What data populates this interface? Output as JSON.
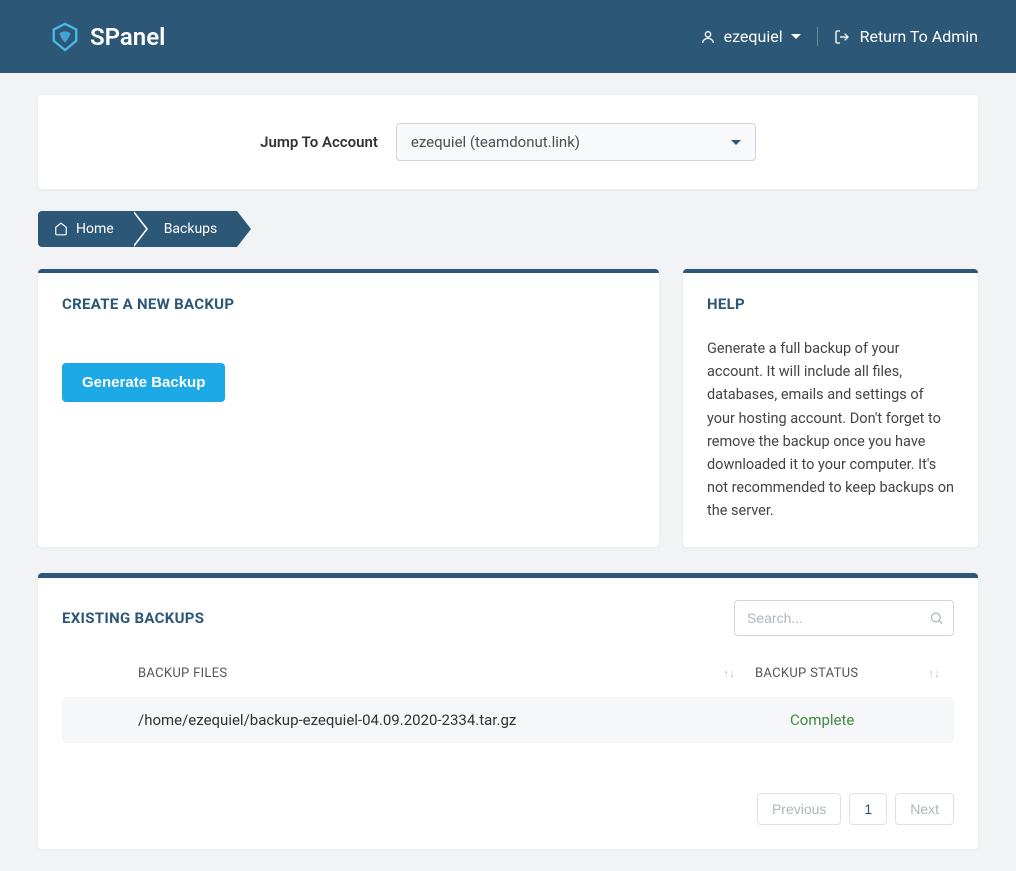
{
  "header": {
    "brand": "SPanel",
    "username": "ezequiel",
    "return_link": "Return To Admin"
  },
  "jump": {
    "label": "Jump To Account",
    "selected": "ezequiel (teamdonut.link)"
  },
  "breadcrumb": {
    "home": "Home",
    "current": "Backups"
  },
  "create_card": {
    "title": "CREATE A NEW BACKUP",
    "button": "Generate Backup"
  },
  "help_card": {
    "title": "HELP",
    "text": "Generate a full backup of your account. It will include all files, databases, emails and settings of your hosting account. Don't forget to remove the backup once you have downloaded it to your computer. It's not recommended to keep backups on the server."
  },
  "existing": {
    "title": "EXISTING BACKUPS",
    "search_placeholder": "Search...",
    "columns": {
      "files": "BACKUP FILES",
      "status": "BACKUP STATUS"
    },
    "rows": [
      {
        "file": "/home/ezequiel/backup-ezequiel-04.09.2020-2334.tar.gz",
        "status": "Complete"
      }
    ],
    "pagination": {
      "prev": "Previous",
      "page": "1",
      "next": "Next"
    }
  }
}
